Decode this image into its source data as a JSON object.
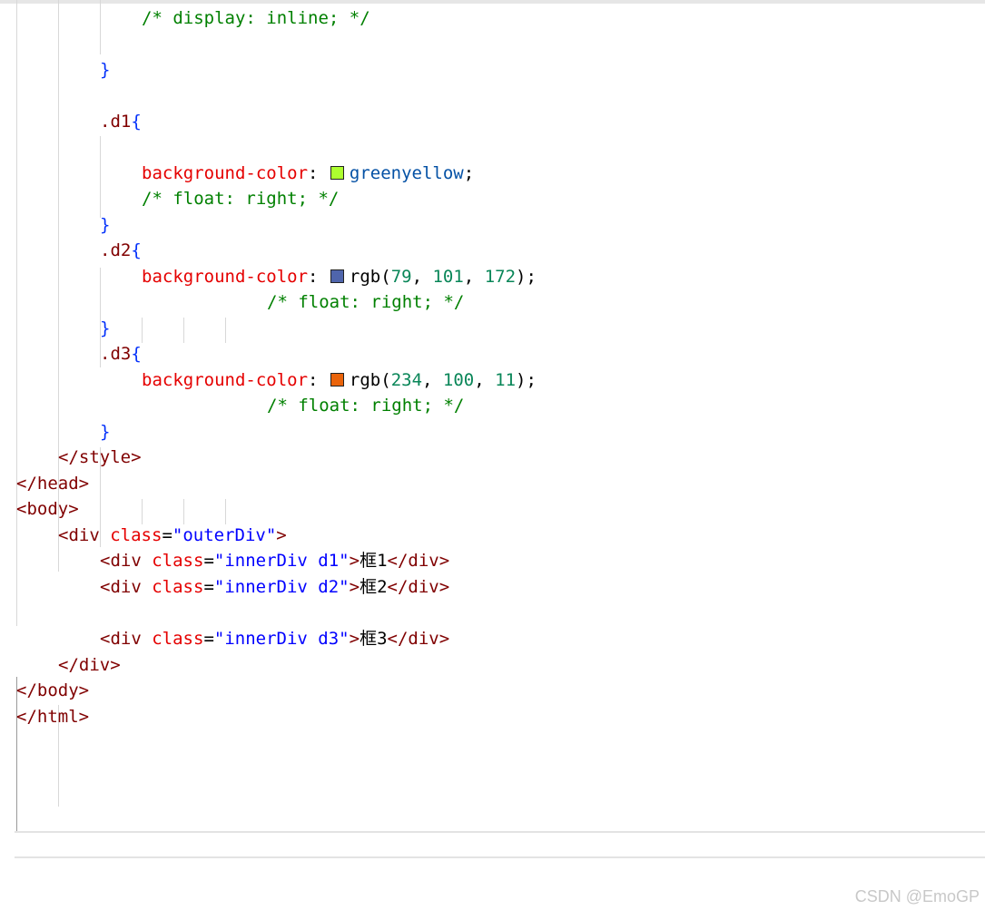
{
  "colors": {
    "comment": "#008000",
    "property": "#e50000",
    "tag": "#800000",
    "punct": "#000000",
    "brace": "#0431fa",
    "selector": "#800000",
    "value": "#0451a5",
    "number": "#098658",
    "attr_name": "#e50000",
    "attr_value": "#0000ff",
    "text": "#000000",
    "greenyellow": "#adff2f",
    "rgb_d2": "#4f65ac",
    "rgb_d3": "#ea640b"
  },
  "lines": [
    {
      "segments": [
        {
          "t": "/* display: inline; */",
          "k": "comment"
        }
      ]
    },
    {
      "segments": []
    },
    {
      "segments": [
        {
          "t": "}",
          "k": "brace"
        }
      ]
    },
    {
      "segments": []
    },
    {
      "segments": [
        {
          "t": ".d1",
          "k": "selector"
        },
        {
          "t": "{",
          "k": "brace"
        }
      ]
    },
    {
      "segments": []
    },
    {
      "segments": [
        {
          "t": "background-color",
          "k": "property"
        },
        {
          "t": ": ",
          "k": "punct"
        },
        {
          "swatch": "greenyellow"
        },
        {
          "t": "greenyellow",
          "k": "value"
        },
        {
          "t": ";",
          "k": "punct"
        }
      ]
    },
    {
      "segments": [
        {
          "t": "/* float: right; */",
          "k": "comment"
        }
      ]
    },
    {
      "segments": [
        {
          "t": "}",
          "k": "brace"
        }
      ]
    },
    {
      "segments": [
        {
          "t": ".d2",
          "k": "selector"
        },
        {
          "t": "{",
          "k": "brace"
        }
      ]
    },
    {
      "segments": []
    },
    {
      "segments": [
        {
          "t": "background-color",
          "k": "property"
        },
        {
          "t": ": ",
          "k": "punct"
        },
        {
          "swatch": "rgb_d2"
        },
        {
          "t": "rgb(",
          "k": "punct"
        },
        {
          "t": "79",
          "k": "number"
        },
        {
          "t": ", ",
          "k": "punct"
        },
        {
          "t": "101",
          "k": "number"
        },
        {
          "t": ", ",
          "k": "punct"
        },
        {
          "t": "172",
          "k": "number"
        },
        {
          "t": ");",
          "k": "punct"
        }
      ]
    },
    {
      "segments": [
        {
          "t": "/* float: right; */",
          "k": "comment"
        }
      ]
    },
    {
      "segments": []
    },
    {
      "segments": [
        {
          "t": "}",
          "k": "brace"
        }
      ]
    },
    {
      "segments": []
    },
    {
      "segments": [
        {
          "t": ".d3",
          "k": "selector"
        },
        {
          "t": "{",
          "k": "brace"
        }
      ]
    },
    {
      "segments": []
    },
    {
      "segments": [
        {
          "t": "background-color",
          "k": "property"
        },
        {
          "t": ": ",
          "k": "punct"
        },
        {
          "swatch": "rgb_d3"
        },
        {
          "t": "rgb(",
          "k": "punct"
        },
        {
          "t": "234",
          "k": "number"
        },
        {
          "t": ", ",
          "k": "punct"
        },
        {
          "t": "100",
          "k": "number"
        },
        {
          "t": ", ",
          "k": "punct"
        },
        {
          "t": "11",
          "k": "number"
        },
        {
          "t": ");",
          "k": "punct"
        }
      ]
    },
    {
      "segments": [
        {
          "t": "/* float: right; */",
          "k": "comment"
        }
      ]
    },
    {
      "segments": []
    },
    {
      "segments": [
        {
          "t": "}",
          "k": "brace"
        }
      ]
    },
    {
      "segments": [
        {
          "t": "</",
          "k": "tag"
        },
        {
          "t": "style",
          "k": "tag"
        },
        {
          "t": ">",
          "k": "tag"
        }
      ]
    },
    {
      "segments": []
    },
    {
      "segments": [
        {
          "t": "</",
          "k": "tag"
        },
        {
          "t": "head",
          "k": "tag"
        },
        {
          "t": ">",
          "k": "tag"
        }
      ]
    },
    {
      "segments": [
        {
          "t": "<",
          "k": "tag"
        },
        {
          "t": "body",
          "k": "tag"
        },
        {
          "t": ">",
          "k": "tag"
        }
      ]
    },
    {
      "segments": [
        {
          "t": "<",
          "k": "tag"
        },
        {
          "t": "div",
          "k": "tag"
        },
        {
          "t": " ",
          "k": "text"
        },
        {
          "t": "class",
          "k": "attr_name"
        },
        {
          "t": "=",
          "k": "text"
        },
        {
          "t": "\"outerDiv\"",
          "k": "attr_value"
        },
        {
          "t": ">",
          "k": "tag"
        }
      ]
    },
    {
      "segments": [
        {
          "t": "<",
          "k": "tag"
        },
        {
          "t": "div",
          "k": "tag"
        },
        {
          "t": " ",
          "k": "text"
        },
        {
          "t": "class",
          "k": "attr_name"
        },
        {
          "t": "=",
          "k": "text"
        },
        {
          "t": "\"innerDiv d1\"",
          "k": "attr_value"
        },
        {
          "t": ">",
          "k": "tag"
        },
        {
          "t": "框1",
          "k": "text"
        },
        {
          "t": "</",
          "k": "tag"
        },
        {
          "t": "div",
          "k": "tag"
        },
        {
          "t": ">",
          "k": "tag"
        }
      ]
    },
    {
      "segments": [
        {
          "t": "<",
          "k": "tag"
        },
        {
          "t": "div",
          "k": "tag"
        },
        {
          "t": " ",
          "k": "text"
        },
        {
          "t": "class",
          "k": "attr_name"
        },
        {
          "t": "=",
          "k": "text"
        },
        {
          "t": "\"innerDiv d2\"",
          "k": "attr_value"
        },
        {
          "t": ">",
          "k": "tag"
        },
        {
          "t": "框2",
          "k": "text"
        },
        {
          "t": "</",
          "k": "tag"
        },
        {
          "t": "div",
          "k": "tag"
        },
        {
          "t": ">",
          "k": "tag"
        }
      ]
    },
    {
      "segments": [
        {
          "t": "<",
          "k": "tag"
        },
        {
          "t": "div",
          "k": "tag"
        },
        {
          "t": " ",
          "k": "text"
        },
        {
          "t": "class",
          "k": "attr_name"
        },
        {
          "t": "=",
          "k": "text"
        },
        {
          "t": "\"innerDiv d3\"",
          "k": "attr_value"
        },
        {
          "t": ">",
          "k": "tag"
        },
        {
          "t": "框3",
          "k": "text"
        },
        {
          "t": "</",
          "k": "tag"
        },
        {
          "t": "div",
          "k": "tag"
        },
        {
          "t": ">",
          "k": "tag"
        }
      ]
    },
    {
      "segments": []
    },
    {
      "segments": [
        {
          "t": "</",
          "k": "tag"
        },
        {
          "t": "div",
          "k": "tag"
        },
        {
          "t": ">",
          "k": "tag"
        }
      ]
    },
    {
      "segments": [
        {
          "t": "</",
          "k": "tag"
        },
        {
          "t": "body",
          "k": "tag"
        },
        {
          "t": ">",
          "k": "tag"
        }
      ]
    },
    {
      "segments": [
        {
          "t": "</",
          "k": "tag"
        },
        {
          "t": "html",
          "k": "tag"
        },
        {
          "t": ">",
          "k": "tag"
        }
      ]
    }
  ],
  "watermark": "CSDN @EmoGP"
}
